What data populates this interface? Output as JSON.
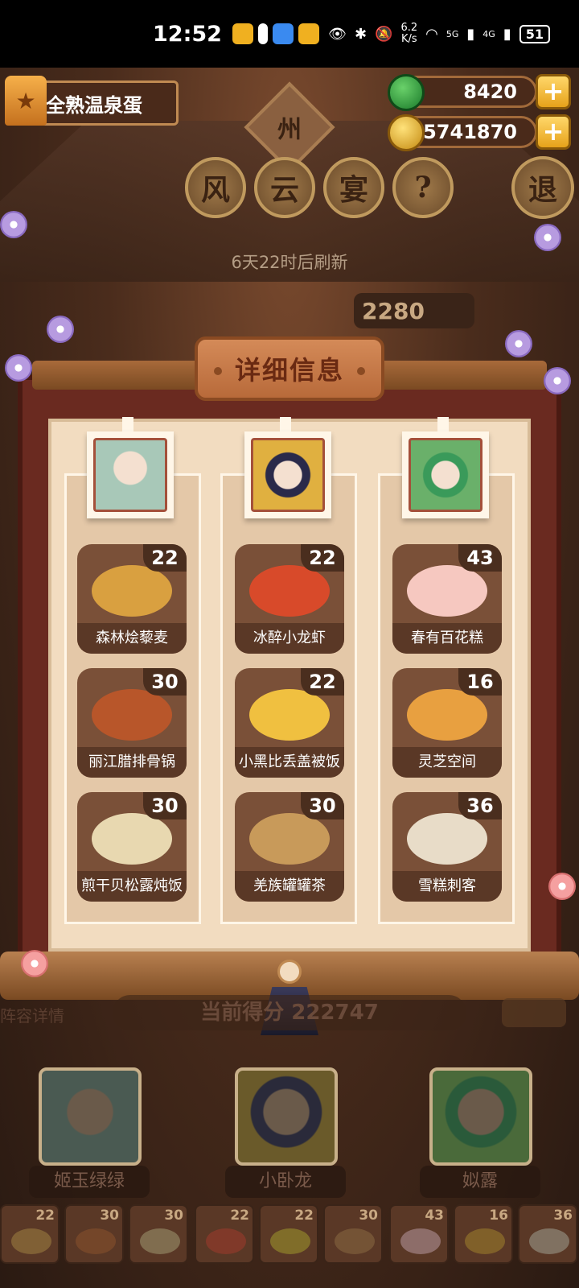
{
  "status_bar": {
    "time": "12:52",
    "net_speed_top": "6.2",
    "net_speed_bottom": "K/s",
    "signal_1": "5G",
    "signal_2": "4G",
    "battery": "51"
  },
  "player": {
    "name": "全熟温泉蛋"
  },
  "currencies": {
    "jade": "8420",
    "coins": "65741870"
  },
  "venue": {
    "sign_char": "州",
    "title_chars": [
      "风",
      "云",
      "宴",
      "?"
    ],
    "exit_label": "退",
    "refresh_text": "6天22时后刷新",
    "background_score": "2280"
  },
  "modal": {
    "title": "详细信息",
    "columns": [
      {
        "character": "姬玉绿绿",
        "dishes": [
          {
            "name": "森林烩藜麦",
            "count": "22",
            "color": "#d9a040"
          },
          {
            "name": "丽江腊排骨锅",
            "count": "30",
            "color": "#b8562a"
          },
          {
            "name": "煎干贝松露炖饭",
            "count": "30",
            "color": "#e8d8b0"
          }
        ]
      },
      {
        "character": "小卧龙",
        "dishes": [
          {
            "name": "冰醉小龙虾",
            "count": "22",
            "color": "#d84a2a"
          },
          {
            "name": "小黑比丢盖被饭",
            "count": "22",
            "color": "#f0c040"
          },
          {
            "name": "羌族罐罐茶",
            "count": "30",
            "color": "#c89a5a"
          }
        ]
      },
      {
        "character": "姒露",
        "dishes": [
          {
            "name": "春有百花糕",
            "count": "43",
            "color": "#f6c8c0"
          },
          {
            "name": "灵芝空间",
            "count": "16",
            "color": "#e8a040"
          },
          {
            "name": "雪糕刺客",
            "count": "36",
            "color": "#e8dcc8"
          }
        ]
      }
    ]
  },
  "bottom": {
    "lineup_label": "阵容详情",
    "score_text": "当前得分 222747",
    "characters": [
      "姬玉绿绿",
      "小卧龙",
      "姒露"
    ],
    "mini_counts": [
      "22",
      "30",
      "30",
      "22",
      "22",
      "30",
      "43",
      "16",
      "36"
    ]
  },
  "colors": {
    "portrait_1": "#a8c8b8",
    "portrait_2": "#e0b040",
    "portrait_3": "#6ab06a"
  }
}
